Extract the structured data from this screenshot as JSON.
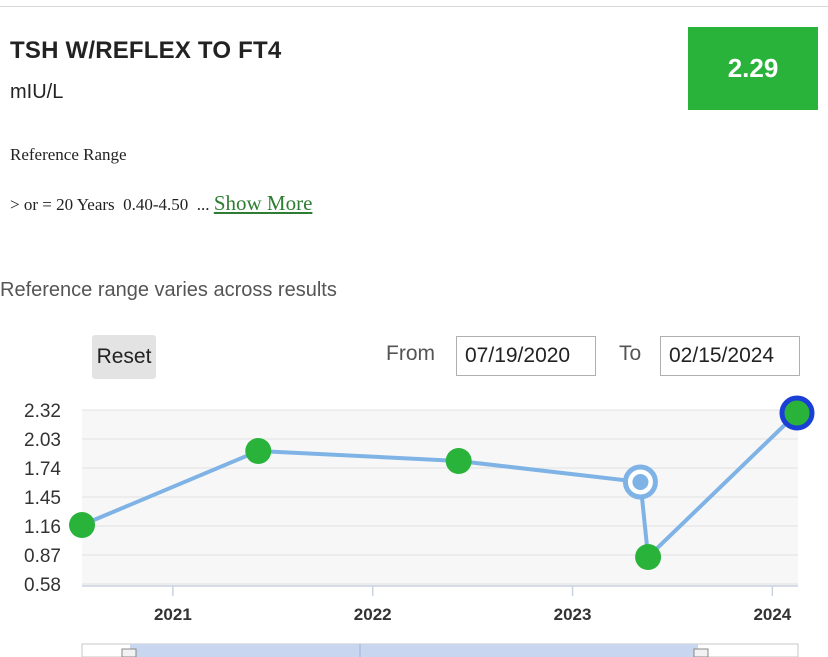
{
  "result": {
    "test_name": "TSH W/REFLEX TO FT4",
    "units": "mIU/L",
    "value": "2.29",
    "value_color": "#2ab33a"
  },
  "reference": {
    "label": "Reference Range",
    "line": "> or = 20 Years  0.40-4.50  ...",
    "show_more": "Show More"
  },
  "chart_header": {
    "note": "Reference range varies across results",
    "reset_label": "Reset",
    "from_label": "From",
    "from_value": "07/19/2020",
    "to_label": "To",
    "to_value": "02/15/2024"
  },
  "chart_data": {
    "type": "line",
    "y_ticks": [
      "2.32",
      "2.03",
      "1.74",
      "1.45",
      "1.16",
      "0.87",
      "0.58"
    ],
    "ylim": [
      0.58,
      2.32
    ],
    "x_ticks": [
      "2021",
      "2022",
      "2023",
      "2024"
    ],
    "xlim": [
      "2020-07-19",
      "2024-02-15"
    ],
    "grid": true,
    "series": [
      {
        "line_color": "#7fb3e6",
        "points": [
          {
            "x": "2020-07-19",
            "y": 1.17,
            "style": "normal"
          },
          {
            "x": "2021-06-06",
            "y": 1.91,
            "style": "normal"
          },
          {
            "x": "2022-06-07",
            "y": 1.81,
            "style": "normal"
          },
          {
            "x": "2023-05-05",
            "y": 1.6,
            "style": "hover"
          },
          {
            "x": "2023-05-19",
            "y": 0.85,
            "style": "normal"
          },
          {
            "x": "2024-02-15",
            "y": 2.29,
            "style": "selected"
          }
        ]
      }
    ],
    "colors": {
      "point": "#2ab33a",
      "hover_ring": "#7fb3e6",
      "selected_ring": "#1a3fd6"
    }
  }
}
